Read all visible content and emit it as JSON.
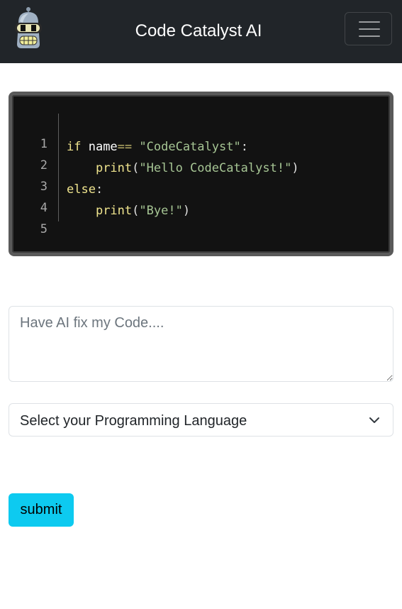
{
  "header": {
    "brand": "Code Catalyst AI",
    "logo_icon": "robot-head-icon",
    "menu_icon": "hamburger-menu-icon"
  },
  "code_block": {
    "line_numbers": [
      "1",
      "2",
      "3",
      "4",
      "5"
    ],
    "lines": [
      {
        "parts": []
      },
      {
        "parts": [
          {
            "cls": "kw",
            "text": "if "
          },
          {
            "cls": "name",
            "text": "name"
          },
          {
            "cls": "op",
            "text": "=="
          },
          {
            "cls": "pl",
            "text": " "
          },
          {
            "cls": "str",
            "text": "\"CodeCatalyst\""
          },
          {
            "cls": "pl",
            "text": ":"
          }
        ]
      },
      {
        "parts": [
          {
            "cls": "pl",
            "text": "    "
          },
          {
            "cls": "fn",
            "text": "print"
          },
          {
            "cls": "pl",
            "text": "("
          },
          {
            "cls": "str",
            "text": "\"Hello CodeCatalyst!\""
          },
          {
            "cls": "pl",
            "text": ")"
          }
        ]
      },
      {
        "parts": [
          {
            "cls": "kw",
            "text": "else"
          },
          {
            "cls": "pl",
            "text": ":"
          }
        ]
      },
      {
        "parts": [
          {
            "cls": "pl",
            "text": "    "
          },
          {
            "cls": "fn",
            "text": "print"
          },
          {
            "cls": "pl",
            "text": "("
          },
          {
            "cls": "str",
            "text": "\"Bye!\""
          },
          {
            "cls": "pl",
            "text": ")"
          }
        ]
      }
    ]
  },
  "form": {
    "prompt_placeholder": "Have AI fix my Code....",
    "prompt_value": "",
    "language_select": "Select your Programming Language",
    "submit_label": "submit"
  },
  "colors": {
    "navbar_bg": "#212529",
    "code_bg": "#121212",
    "submit_bg": "#0dcaf0"
  }
}
